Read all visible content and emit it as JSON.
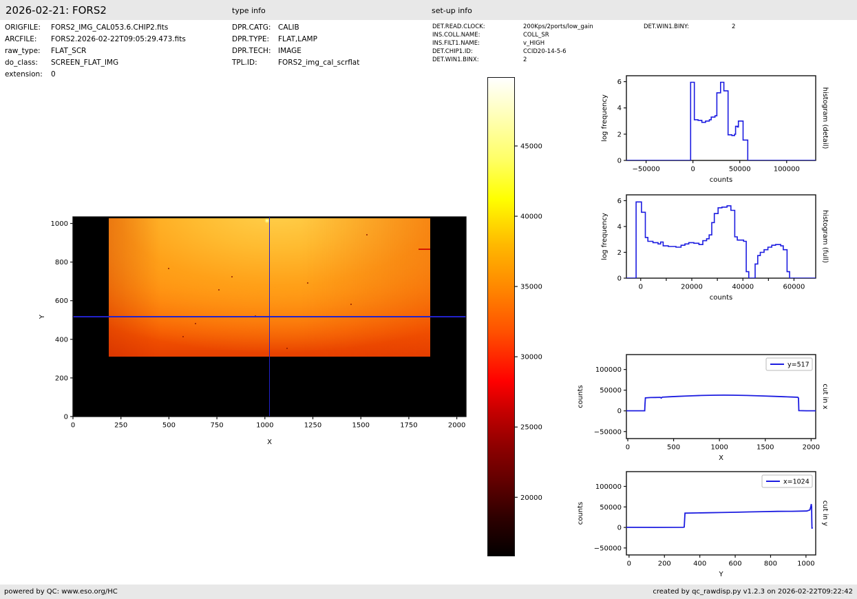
{
  "header": {
    "title": "2026-02-21: FORS2",
    "type_info_title": "type info",
    "setup_info_title": "set-up info"
  },
  "file_info": {
    "rows": [
      {
        "label": "ORIGFILE:",
        "value": "FORS2_IMG_CAL053.6.CHIP2.fits"
      },
      {
        "label": "ARCFILE:",
        "value": "FORS2.2026-02-22T09:05:29.473.fits"
      },
      {
        "label": "raw_type:",
        "value": "FLAT_SCR"
      },
      {
        "label": "do_class:",
        "value": "SCREEN_FLAT_IMG"
      },
      {
        "label": "extension:",
        "value": "0"
      }
    ]
  },
  "type_info": {
    "rows": [
      {
        "label": "DPR.CATG:",
        "value": "CALIB"
      },
      {
        "label": "DPR.TYPE:",
        "value": "FLAT,LAMP"
      },
      {
        "label": "DPR.TECH:",
        "value": "IMAGE"
      },
      {
        "label": "TPL.ID:",
        "value": "FORS2_img_cal_scrflat"
      }
    ]
  },
  "setup_info": {
    "col1": [
      {
        "label": "DET.READ.CLOCK:",
        "value": "200Kps/2ports/low_gain"
      },
      {
        "label": "INS.COLL.NAME:",
        "value": "COLL_SR"
      },
      {
        "label": "INS.FILT1.NAME:",
        "value": "v_HIGH"
      },
      {
        "label": "DET.CHIP1.ID:",
        "value": "CCID20-14-5-6"
      },
      {
        "label": "DET.WIN1.BINX:",
        "value": "2"
      }
    ],
    "col2": [
      {
        "label": "DET.WIN1.BINY:",
        "value": "2"
      }
    ]
  },
  "footer": {
    "left": "powered by QC: www.eso.org/HC",
    "right": "created by qc_rawdisp.py v1.2.3 on 2026-02-22T09:22:42"
  },
  "colors": {
    "curve_blue": "#1b1be0",
    "crosshair_blue": "#2222cc",
    "frame_black": "#111111",
    "bar_gray": "#e8e8e8"
  },
  "chart_data": [
    {
      "id": "main",
      "type": "heatmap",
      "xlabel": "X",
      "ylabel": "Y",
      "xlim": [
        0,
        2048
      ],
      "ylim": [
        0,
        1034
      ],
      "xticks": [
        [
          0,
          "0"
        ],
        [
          250,
          "250"
        ],
        [
          500,
          "500"
        ],
        [
          750,
          "750"
        ],
        [
          1000,
          "1000"
        ],
        [
          1250,
          "1250"
        ],
        [
          1500,
          "1500"
        ],
        [
          1750,
          "1750"
        ],
        [
          2000,
          "2000"
        ]
      ],
      "yticks": [
        [
          0,
          "0"
        ],
        [
          200,
          "200"
        ],
        [
          400,
          "400"
        ],
        [
          600,
          "600"
        ],
        [
          800,
          "800"
        ],
        [
          1000,
          "1000"
        ]
      ],
      "illuminated_region": {
        "x": [
          185,
          1861
        ],
        "y": [
          311,
          1026
        ]
      },
      "crosshair": {
        "x": 1024,
        "y": 517
      },
      "features": {
        "bright_spot": {
          "x": 1010,
          "y": 1015
        },
        "red_line": {
          "x": [
            1800,
            1861
          ],
          "y": 866
        },
        "speckles": [
          [
            500,
            767
          ],
          [
            830,
            725
          ],
          [
            760,
            655
          ],
          [
            640,
            480
          ],
          [
            575,
            415
          ],
          [
            1223,
            690
          ],
          [
            1530,
            940
          ],
          [
            1450,
            580
          ],
          [
            1115,
            352
          ],
          [
            950,
            520
          ]
        ]
      }
    },
    {
      "id": "colorbar",
      "type": "colorbar",
      "colormap": "hot",
      "vmin": 15800,
      "vmax": 49900,
      "ticks": [
        [
          20000,
          "20000"
        ],
        [
          25000,
          "25000"
        ],
        [
          30000,
          "30000"
        ],
        [
          35000,
          "35000"
        ],
        [
          40000,
          "40000"
        ],
        [
          45000,
          "45000"
        ]
      ]
    },
    {
      "id": "hist_detail",
      "type": "line",
      "right_label": "histogram (detail)",
      "xlabel": "counts",
      "ylabel": "log frequency",
      "xlim": [
        -71000,
        131000
      ],
      "ylim": [
        0,
        6.45
      ],
      "xticks": [
        [
          -50000,
          "−50000"
        ],
        [
          0,
          "0"
        ],
        [
          50000,
          "50000"
        ],
        [
          100000,
          "100000"
        ]
      ],
      "yticks": [
        [
          0,
          "0"
        ],
        [
          2,
          "2"
        ],
        [
          4,
          "4"
        ],
        [
          6,
          "6"
        ]
      ],
      "points": [
        [
          -71000,
          0
        ],
        [
          -2500,
          0
        ],
        [
          -2500,
          5.95
        ],
        [
          1500,
          5.95
        ],
        [
          1500,
          3.1
        ],
        [
          5500,
          3.1
        ],
        [
          5500,
          3.05
        ],
        [
          9500,
          3.05
        ],
        [
          9500,
          2.9
        ],
        [
          13500,
          2.9
        ],
        [
          13500,
          3.0
        ],
        [
          17500,
          3.0
        ],
        [
          17500,
          3.1
        ],
        [
          19500,
          3.1
        ],
        [
          19500,
          3.3
        ],
        [
          23500,
          3.3
        ],
        [
          23500,
          3.4
        ],
        [
          25500,
          3.4
        ],
        [
          25500,
          5.15
        ],
        [
          29500,
          5.15
        ],
        [
          29500,
          5.95
        ],
        [
          33000,
          5.95
        ],
        [
          33000,
          5.3
        ],
        [
          37500,
          5.3
        ],
        [
          37500,
          1.95
        ],
        [
          41500,
          1.95
        ],
        [
          41500,
          1.9
        ],
        [
          44500,
          1.9
        ],
        [
          44500,
          2.0
        ],
        [
          45500,
          2.0
        ],
        [
          45500,
          2.6
        ],
        [
          47500,
          2.6
        ],
        [
          47500,
          2.55
        ],
        [
          48500,
          2.55
        ],
        [
          48500,
          3.0
        ],
        [
          53500,
          3.0
        ],
        [
          53500,
          1.55
        ],
        [
          58500,
          1.55
        ],
        [
          58500,
          0
        ],
        [
          131000,
          0
        ]
      ]
    },
    {
      "id": "hist_full",
      "type": "line",
      "right_label": "histogram (full)",
      "xlabel": "counts",
      "ylabel": "log frequency",
      "xlim": [
        -5600,
        68500
      ],
      "ylim": [
        0,
        6.45
      ],
      "xticks": [
        [
          0,
          "0"
        ],
        [
          10000,
          ""
        ],
        [
          20000,
          "20000"
        ],
        [
          30000,
          ""
        ],
        [
          40000,
          "40000"
        ],
        [
          50000,
          ""
        ],
        [
          60000,
          "60000"
        ]
      ],
      "yticks": [
        [
          0,
          "0"
        ],
        [
          2,
          "2"
        ],
        [
          4,
          "4"
        ],
        [
          6,
          "6"
        ]
      ],
      "points": [
        [
          -5600,
          0
        ],
        [
          -1800,
          0
        ],
        [
          -1800,
          5.9
        ],
        [
          300,
          5.9
        ],
        [
          300,
          5.1
        ],
        [
          1800,
          5.1
        ],
        [
          1800,
          3.15
        ],
        [
          2800,
          3.15
        ],
        [
          2800,
          2.85
        ],
        [
          4800,
          2.85
        ],
        [
          4800,
          2.75
        ],
        [
          6800,
          2.75
        ],
        [
          6800,
          2.65
        ],
        [
          7800,
          2.65
        ],
        [
          7800,
          2.8
        ],
        [
          8800,
          2.8
        ],
        [
          8800,
          2.5
        ],
        [
          10800,
          2.5
        ],
        [
          10800,
          2.45
        ],
        [
          13800,
          2.45
        ],
        [
          13800,
          2.4
        ],
        [
          15800,
          2.4
        ],
        [
          15800,
          2.55
        ],
        [
          17300,
          2.55
        ],
        [
          17300,
          2.65
        ],
        [
          18800,
          2.65
        ],
        [
          18800,
          2.75
        ],
        [
          20800,
          2.75
        ],
        [
          20800,
          2.7
        ],
        [
          22800,
          2.7
        ],
        [
          22800,
          2.6
        ],
        [
          24300,
          2.6
        ],
        [
          24300,
          2.9
        ],
        [
          25800,
          2.9
        ],
        [
          25800,
          3.05
        ],
        [
          26800,
          3.05
        ],
        [
          26800,
          3.35
        ],
        [
          27800,
          3.35
        ],
        [
          27800,
          4.3
        ],
        [
          28800,
          4.3
        ],
        [
          28800,
          5.0
        ],
        [
          30300,
          5.0
        ],
        [
          30300,
          5.45
        ],
        [
          31800,
          5.45
        ],
        [
          31800,
          5.5
        ],
        [
          33800,
          5.5
        ],
        [
          33800,
          5.6
        ],
        [
          35300,
          5.6
        ],
        [
          35300,
          5.25
        ],
        [
          36800,
          5.25
        ],
        [
          36800,
          3.2
        ],
        [
          37800,
          3.2
        ],
        [
          37800,
          2.95
        ],
        [
          40300,
          2.95
        ],
        [
          40300,
          2.85
        ],
        [
          41300,
          2.85
        ],
        [
          41300,
          0.5
        ],
        [
          42300,
          0.5
        ],
        [
          42300,
          0
        ],
        [
          44800,
          0
        ],
        [
          44800,
          1.1
        ],
        [
          45800,
          1.1
        ],
        [
          45800,
          1.75
        ],
        [
          46800,
          1.75
        ],
        [
          46800,
          2.0
        ],
        [
          48300,
          2.0
        ],
        [
          48300,
          2.2
        ],
        [
          49800,
          2.2
        ],
        [
          49800,
          2.4
        ],
        [
          51300,
          2.4
        ],
        [
          51300,
          2.55
        ],
        [
          52800,
          2.55
        ],
        [
          52800,
          2.6
        ],
        [
          54800,
          2.6
        ],
        [
          54800,
          2.5
        ],
        [
          55800,
          2.5
        ],
        [
          55800,
          2.2
        ],
        [
          57300,
          2.2
        ],
        [
          57300,
          0.5
        ],
        [
          58300,
          0.5
        ],
        [
          58300,
          0
        ],
        [
          68500,
          0
        ]
      ]
    },
    {
      "id": "cut_x",
      "type": "line",
      "legend": "y=517",
      "right_label": "cut in x",
      "xlabel": "X",
      "ylabel": "counts",
      "xlim": [
        -15,
        2050
      ],
      "ylim": [
        -67000,
        136000
      ],
      "xticks": [
        [
          0,
          "0"
        ],
        [
          500,
          "500"
        ],
        [
          1000,
          "1000"
        ],
        [
          1500,
          "1500"
        ],
        [
          2000,
          "2000"
        ]
      ],
      "yticks": [
        [
          -50000,
          "−50000"
        ],
        [
          0,
          "0"
        ],
        [
          50000,
          "50000"
        ],
        [
          100000,
          "100000"
        ]
      ],
      "points": [
        [
          -15,
          300
        ],
        [
          100,
          200
        ],
        [
          185,
          300
        ],
        [
          188,
          16000
        ],
        [
          192,
          31500
        ],
        [
          250,
          32200
        ],
        [
          300,
          32400
        ],
        [
          355,
          32600
        ],
        [
          365,
          30800
        ],
        [
          375,
          33000
        ],
        [
          450,
          34000
        ],
        [
          550,
          35000
        ],
        [
          650,
          36000
        ],
        [
          800,
          37200
        ],
        [
          950,
          37800
        ],
        [
          1050,
          38000
        ],
        [
          1150,
          37900
        ],
        [
          1300,
          37200
        ],
        [
          1450,
          36200
        ],
        [
          1600,
          35000
        ],
        [
          1700,
          34200
        ],
        [
          1800,
          33400
        ],
        [
          1855,
          32800
        ],
        [
          1862,
          31000
        ],
        [
          1866,
          500
        ],
        [
          1950,
          200
        ],
        [
          2050,
          300
        ]
      ]
    },
    {
      "id": "cut_y",
      "type": "line",
      "legend": "x=1024",
      "right_label": "cut in y",
      "xlabel": "Y",
      "ylabel": "counts",
      "xlim": [
        -15,
        1055
      ],
      "ylim": [
        -67000,
        136000
      ],
      "xticks": [
        [
          0,
          "0"
        ],
        [
          200,
          "200"
        ],
        [
          400,
          "400"
        ],
        [
          600,
          "600"
        ],
        [
          800,
          "800"
        ],
        [
          1000,
          "1000"
        ]
      ],
      "yticks": [
        [
          -50000,
          "−50000"
        ],
        [
          0,
          "0"
        ],
        [
          50000,
          "50000"
        ],
        [
          100000,
          "100000"
        ]
      ],
      "points": [
        [
          -15,
          200
        ],
        [
          150,
          100
        ],
        [
          305,
          200
        ],
        [
          312,
          1000
        ],
        [
          316,
          34800
        ],
        [
          380,
          35300
        ],
        [
          450,
          35800
        ],
        [
          520,
          36400
        ],
        [
          600,
          37100
        ],
        [
          680,
          37800
        ],
        [
          760,
          38600
        ],
        [
          840,
          39200
        ],
        [
          920,
          39400
        ],
        [
          980,
          39800
        ],
        [
          1005,
          40000
        ],
        [
          1015,
          41500
        ],
        [
          1022,
          42500
        ],
        [
          1027,
          50000
        ],
        [
          1030,
          57000
        ],
        [
          1032,
          50000
        ],
        [
          1033,
          20000
        ],
        [
          1034,
          -3000
        ],
        [
          1036,
          500
        ]
      ]
    }
  ]
}
